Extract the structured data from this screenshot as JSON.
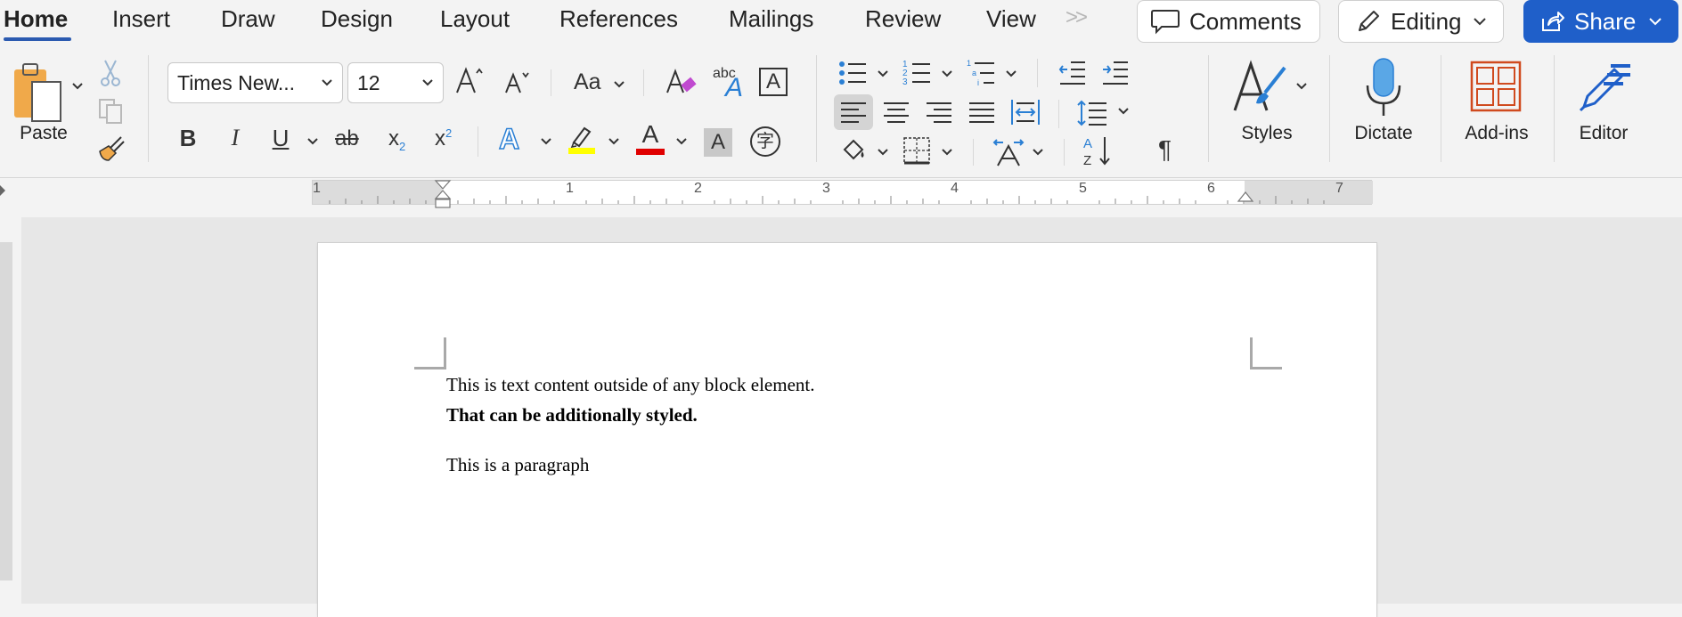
{
  "tabs": [
    {
      "label": "Home",
      "active": true
    },
    {
      "label": "Insert"
    },
    {
      "label": "Draw"
    },
    {
      "label": "Design"
    },
    {
      "label": "Layout"
    },
    {
      "label": "References"
    },
    {
      "label": "Mailings"
    },
    {
      "label": "Review"
    },
    {
      "label": "View"
    }
  ],
  "more_tabs_glyph": ">>",
  "actions": {
    "comments_label": "Comments",
    "editing_label": "Editing",
    "share_label": "Share"
  },
  "clipboard": {
    "paste_label": "Paste"
  },
  "font": {
    "family": "Times New...",
    "size": "12",
    "change_case_label": "Aa",
    "bold": "B",
    "italic": "I",
    "underline": "U",
    "strike": "ab",
    "subscript": "x",
    "subscript_mark": "2",
    "superscript": "x",
    "superscript_mark": "2",
    "text_effects": "A",
    "font_color": "A",
    "shading": "A",
    "phonetic": "字",
    "abc": "abc",
    "char_border": "A"
  },
  "colors": {
    "highlight": "#ffff00",
    "font_color": "#e00000",
    "share": "#1f5fc9",
    "accent_blue": "#2b5ab0",
    "addins_orange": "#d04a1e",
    "dictate_blue": "#5aa7e6"
  },
  "paragraph": {
    "pilcrow": "¶"
  },
  "big_buttons": {
    "styles_label": "Styles",
    "dictate_label": "Dictate",
    "addins_label": "Add-ins",
    "editor_label": "Editor"
  },
  "ruler": {
    "numbers": [
      "1",
      "1",
      "2",
      "3",
      "4",
      "5",
      "6",
      "7"
    ]
  },
  "document": {
    "line1": "This is text content outside of any block element.",
    "line2": "That can be additionally styled.",
    "line3": "This is a paragraph"
  },
  "icons": [
    "cut-icon",
    "copy-icon",
    "format-painter-icon",
    "bullets-icon",
    "numbering-icon",
    "multilevel-icon",
    "decrease-indent-icon",
    "increase-indent-icon",
    "align-left-icon",
    "center-icon",
    "align-right-icon",
    "justify-icon",
    "distributed-icon",
    "line-spacing-icon",
    "shading-icon",
    "borders-icon",
    "sort-icon",
    "pilcrow-icon",
    "styles-icon",
    "microphone-icon",
    "addins-icon",
    "editor-pen-icon",
    "comment-icon",
    "pencil-icon",
    "share-icon"
  ]
}
